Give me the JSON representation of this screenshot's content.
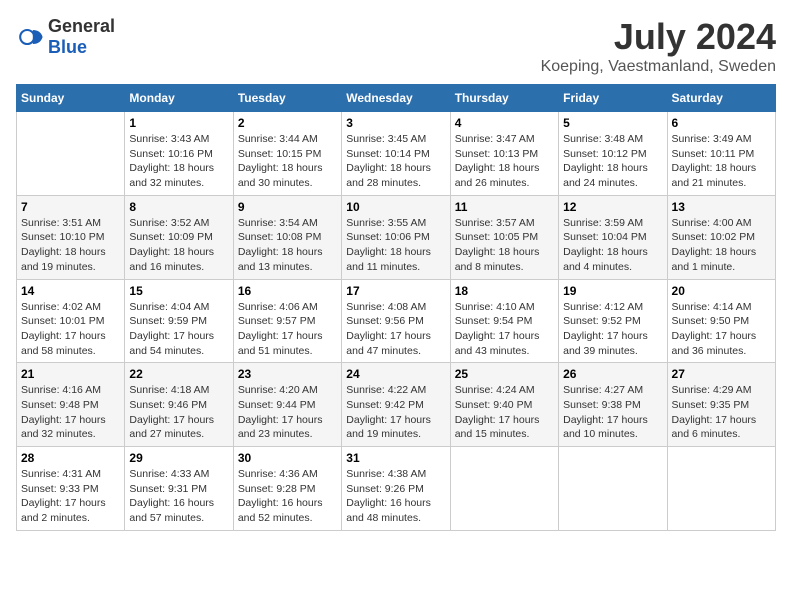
{
  "logo": {
    "general": "General",
    "blue": "Blue"
  },
  "title": "July 2024",
  "subtitle": "Koeping, Vaestmanland, Sweden",
  "days_header": [
    "Sunday",
    "Monday",
    "Tuesday",
    "Wednesday",
    "Thursday",
    "Friday",
    "Saturday"
  ],
  "weeks": [
    [
      {
        "day": "",
        "info": ""
      },
      {
        "day": "1",
        "info": "Sunrise: 3:43 AM\nSunset: 10:16 PM\nDaylight: 18 hours\nand 32 minutes."
      },
      {
        "day": "2",
        "info": "Sunrise: 3:44 AM\nSunset: 10:15 PM\nDaylight: 18 hours\nand 30 minutes."
      },
      {
        "day": "3",
        "info": "Sunrise: 3:45 AM\nSunset: 10:14 PM\nDaylight: 18 hours\nand 28 minutes."
      },
      {
        "day": "4",
        "info": "Sunrise: 3:47 AM\nSunset: 10:13 PM\nDaylight: 18 hours\nand 26 minutes."
      },
      {
        "day": "5",
        "info": "Sunrise: 3:48 AM\nSunset: 10:12 PM\nDaylight: 18 hours\nand 24 minutes."
      },
      {
        "day": "6",
        "info": "Sunrise: 3:49 AM\nSunset: 10:11 PM\nDaylight: 18 hours\nand 21 minutes."
      }
    ],
    [
      {
        "day": "7",
        "info": "Sunrise: 3:51 AM\nSunset: 10:10 PM\nDaylight: 18 hours\nand 19 minutes."
      },
      {
        "day": "8",
        "info": "Sunrise: 3:52 AM\nSunset: 10:09 PM\nDaylight: 18 hours\nand 16 minutes."
      },
      {
        "day": "9",
        "info": "Sunrise: 3:54 AM\nSunset: 10:08 PM\nDaylight: 18 hours\nand 13 minutes."
      },
      {
        "day": "10",
        "info": "Sunrise: 3:55 AM\nSunset: 10:06 PM\nDaylight: 18 hours\nand 11 minutes."
      },
      {
        "day": "11",
        "info": "Sunrise: 3:57 AM\nSunset: 10:05 PM\nDaylight: 18 hours\nand 8 minutes."
      },
      {
        "day": "12",
        "info": "Sunrise: 3:59 AM\nSunset: 10:04 PM\nDaylight: 18 hours\nand 4 minutes."
      },
      {
        "day": "13",
        "info": "Sunrise: 4:00 AM\nSunset: 10:02 PM\nDaylight: 18 hours\nand 1 minute."
      }
    ],
    [
      {
        "day": "14",
        "info": "Sunrise: 4:02 AM\nSunset: 10:01 PM\nDaylight: 17 hours\nand 58 minutes."
      },
      {
        "day": "15",
        "info": "Sunrise: 4:04 AM\nSunset: 9:59 PM\nDaylight: 17 hours\nand 54 minutes."
      },
      {
        "day": "16",
        "info": "Sunrise: 4:06 AM\nSunset: 9:57 PM\nDaylight: 17 hours\nand 51 minutes."
      },
      {
        "day": "17",
        "info": "Sunrise: 4:08 AM\nSunset: 9:56 PM\nDaylight: 17 hours\nand 47 minutes."
      },
      {
        "day": "18",
        "info": "Sunrise: 4:10 AM\nSunset: 9:54 PM\nDaylight: 17 hours\nand 43 minutes."
      },
      {
        "day": "19",
        "info": "Sunrise: 4:12 AM\nSunset: 9:52 PM\nDaylight: 17 hours\nand 39 minutes."
      },
      {
        "day": "20",
        "info": "Sunrise: 4:14 AM\nSunset: 9:50 PM\nDaylight: 17 hours\nand 36 minutes."
      }
    ],
    [
      {
        "day": "21",
        "info": "Sunrise: 4:16 AM\nSunset: 9:48 PM\nDaylight: 17 hours\nand 32 minutes."
      },
      {
        "day": "22",
        "info": "Sunrise: 4:18 AM\nSunset: 9:46 PM\nDaylight: 17 hours\nand 27 minutes."
      },
      {
        "day": "23",
        "info": "Sunrise: 4:20 AM\nSunset: 9:44 PM\nDaylight: 17 hours\nand 23 minutes."
      },
      {
        "day": "24",
        "info": "Sunrise: 4:22 AM\nSunset: 9:42 PM\nDaylight: 17 hours\nand 19 minutes."
      },
      {
        "day": "25",
        "info": "Sunrise: 4:24 AM\nSunset: 9:40 PM\nDaylight: 17 hours\nand 15 minutes."
      },
      {
        "day": "26",
        "info": "Sunrise: 4:27 AM\nSunset: 9:38 PM\nDaylight: 17 hours\nand 10 minutes."
      },
      {
        "day": "27",
        "info": "Sunrise: 4:29 AM\nSunset: 9:35 PM\nDaylight: 17 hours\nand 6 minutes."
      }
    ],
    [
      {
        "day": "28",
        "info": "Sunrise: 4:31 AM\nSunset: 9:33 PM\nDaylight: 17 hours\nand 2 minutes."
      },
      {
        "day": "29",
        "info": "Sunrise: 4:33 AM\nSunset: 9:31 PM\nDaylight: 16 hours\nand 57 minutes."
      },
      {
        "day": "30",
        "info": "Sunrise: 4:36 AM\nSunset: 9:28 PM\nDaylight: 16 hours\nand 52 minutes."
      },
      {
        "day": "31",
        "info": "Sunrise: 4:38 AM\nSunset: 9:26 PM\nDaylight: 16 hours\nand 48 minutes."
      },
      {
        "day": "",
        "info": ""
      },
      {
        "day": "",
        "info": ""
      },
      {
        "day": "",
        "info": ""
      }
    ]
  ]
}
